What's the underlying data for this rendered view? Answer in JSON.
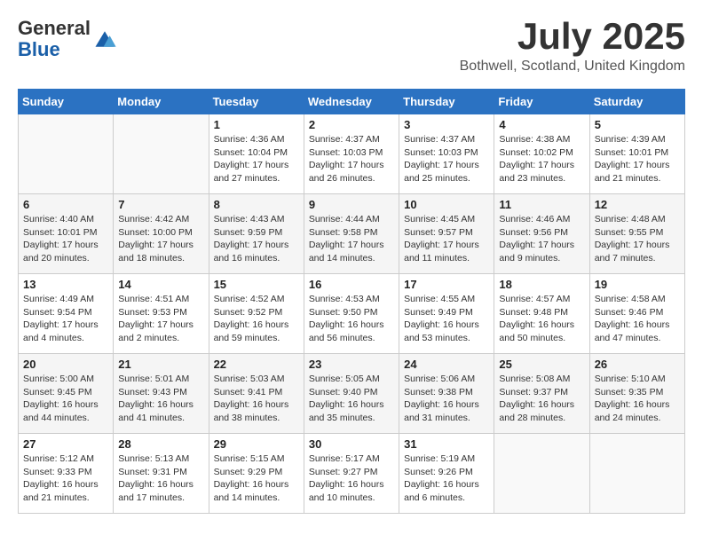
{
  "header": {
    "logo_line1": "General",
    "logo_line2": "Blue",
    "month_title": "July 2025",
    "location": "Bothwell, Scotland, United Kingdom"
  },
  "days_of_week": [
    "Sunday",
    "Monday",
    "Tuesday",
    "Wednesday",
    "Thursday",
    "Friday",
    "Saturday"
  ],
  "weeks": [
    [
      {
        "day": "",
        "info": ""
      },
      {
        "day": "",
        "info": ""
      },
      {
        "day": "1",
        "info": "Sunrise: 4:36 AM\nSunset: 10:04 PM\nDaylight: 17 hours and 27 minutes."
      },
      {
        "day": "2",
        "info": "Sunrise: 4:37 AM\nSunset: 10:03 PM\nDaylight: 17 hours and 26 minutes."
      },
      {
        "day": "3",
        "info": "Sunrise: 4:37 AM\nSunset: 10:03 PM\nDaylight: 17 hours and 25 minutes."
      },
      {
        "day": "4",
        "info": "Sunrise: 4:38 AM\nSunset: 10:02 PM\nDaylight: 17 hours and 23 minutes."
      },
      {
        "day": "5",
        "info": "Sunrise: 4:39 AM\nSunset: 10:01 PM\nDaylight: 17 hours and 21 minutes."
      }
    ],
    [
      {
        "day": "6",
        "info": "Sunrise: 4:40 AM\nSunset: 10:01 PM\nDaylight: 17 hours and 20 minutes."
      },
      {
        "day": "7",
        "info": "Sunrise: 4:42 AM\nSunset: 10:00 PM\nDaylight: 17 hours and 18 minutes."
      },
      {
        "day": "8",
        "info": "Sunrise: 4:43 AM\nSunset: 9:59 PM\nDaylight: 17 hours and 16 minutes."
      },
      {
        "day": "9",
        "info": "Sunrise: 4:44 AM\nSunset: 9:58 PM\nDaylight: 17 hours and 14 minutes."
      },
      {
        "day": "10",
        "info": "Sunrise: 4:45 AM\nSunset: 9:57 PM\nDaylight: 17 hours and 11 minutes."
      },
      {
        "day": "11",
        "info": "Sunrise: 4:46 AM\nSunset: 9:56 PM\nDaylight: 17 hours and 9 minutes."
      },
      {
        "day": "12",
        "info": "Sunrise: 4:48 AM\nSunset: 9:55 PM\nDaylight: 17 hours and 7 minutes."
      }
    ],
    [
      {
        "day": "13",
        "info": "Sunrise: 4:49 AM\nSunset: 9:54 PM\nDaylight: 17 hours and 4 minutes."
      },
      {
        "day": "14",
        "info": "Sunrise: 4:51 AM\nSunset: 9:53 PM\nDaylight: 17 hours and 2 minutes."
      },
      {
        "day": "15",
        "info": "Sunrise: 4:52 AM\nSunset: 9:52 PM\nDaylight: 16 hours and 59 minutes."
      },
      {
        "day": "16",
        "info": "Sunrise: 4:53 AM\nSunset: 9:50 PM\nDaylight: 16 hours and 56 minutes."
      },
      {
        "day": "17",
        "info": "Sunrise: 4:55 AM\nSunset: 9:49 PM\nDaylight: 16 hours and 53 minutes."
      },
      {
        "day": "18",
        "info": "Sunrise: 4:57 AM\nSunset: 9:48 PM\nDaylight: 16 hours and 50 minutes."
      },
      {
        "day": "19",
        "info": "Sunrise: 4:58 AM\nSunset: 9:46 PM\nDaylight: 16 hours and 47 minutes."
      }
    ],
    [
      {
        "day": "20",
        "info": "Sunrise: 5:00 AM\nSunset: 9:45 PM\nDaylight: 16 hours and 44 minutes."
      },
      {
        "day": "21",
        "info": "Sunrise: 5:01 AM\nSunset: 9:43 PM\nDaylight: 16 hours and 41 minutes."
      },
      {
        "day": "22",
        "info": "Sunrise: 5:03 AM\nSunset: 9:41 PM\nDaylight: 16 hours and 38 minutes."
      },
      {
        "day": "23",
        "info": "Sunrise: 5:05 AM\nSunset: 9:40 PM\nDaylight: 16 hours and 35 minutes."
      },
      {
        "day": "24",
        "info": "Sunrise: 5:06 AM\nSunset: 9:38 PM\nDaylight: 16 hours and 31 minutes."
      },
      {
        "day": "25",
        "info": "Sunrise: 5:08 AM\nSunset: 9:37 PM\nDaylight: 16 hours and 28 minutes."
      },
      {
        "day": "26",
        "info": "Sunrise: 5:10 AM\nSunset: 9:35 PM\nDaylight: 16 hours and 24 minutes."
      }
    ],
    [
      {
        "day": "27",
        "info": "Sunrise: 5:12 AM\nSunset: 9:33 PM\nDaylight: 16 hours and 21 minutes."
      },
      {
        "day": "28",
        "info": "Sunrise: 5:13 AM\nSunset: 9:31 PM\nDaylight: 16 hours and 17 minutes."
      },
      {
        "day": "29",
        "info": "Sunrise: 5:15 AM\nSunset: 9:29 PM\nDaylight: 16 hours and 14 minutes."
      },
      {
        "day": "30",
        "info": "Sunrise: 5:17 AM\nSunset: 9:27 PM\nDaylight: 16 hours and 10 minutes."
      },
      {
        "day": "31",
        "info": "Sunrise: 5:19 AM\nSunset: 9:26 PM\nDaylight: 16 hours and 6 minutes."
      },
      {
        "day": "",
        "info": ""
      },
      {
        "day": "",
        "info": ""
      }
    ]
  ]
}
